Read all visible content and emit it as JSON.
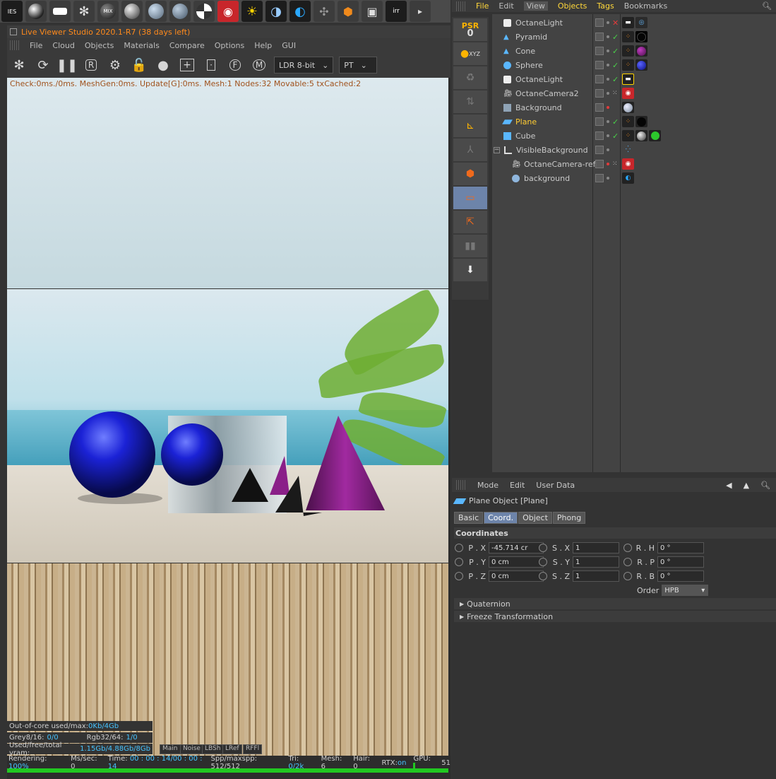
{
  "toolbar": {
    "first_label": "IES",
    "mix_label": "MIX"
  },
  "viewer": {
    "title": "Live Viewer Studio 2020.1-R7 (38 days left)",
    "menu": [
      "File",
      "Cloud",
      "Objects",
      "Materials",
      "Compare",
      "Options",
      "Help",
      "GUI"
    ],
    "tone_select": "LDR 8-bit",
    "kernel_select": "PT",
    "render_status": "Check:0ms./0ms. MeshGen:0ms. Update[G]:0ms. Mesh:1 Nodes:32 Movable:5 txCached:2",
    "info": {
      "outofcore_label": "Out-of-core used/max:",
      "outofcore_value": "0Kb/4Gb",
      "grey_label": "Grey8/16:",
      "grey_value": "0/0",
      "rgb_label": "Rgb32/64:",
      "rgb_value": "1/0",
      "vram_label": "Used/free/total vram:",
      "vram_value": "1.15Gb/4.88Gb/8Gb"
    },
    "passes": [
      "Main",
      "Noise",
      "LBSh",
      "LRef",
      "RFFl"
    ],
    "status": {
      "rendering_label": "Rendering:",
      "rendering_value": "100%",
      "mssec_label": "Ms/sec:",
      "mssec_value": "0",
      "time_label": "Time:",
      "time_value": "00 : 00 : 14/00 : 00 : 14",
      "spp_label": "Spp/maxspp:",
      "spp_value": "512/512",
      "tri_label": "Tri:",
      "tri_value": "0/2k",
      "mesh_label": "Mesh:",
      "mesh_value": "6",
      "hair_label": "Hair:",
      "hair_value": "0",
      "rtx_label": "RTX:",
      "rtx_value": "on",
      "gpu_label": "GPU:",
      "gpu_value": "51"
    },
    "progress": 1.0
  },
  "side_icons": {
    "psr_label": "PSR",
    "psr_value": "0",
    "xyz_label": "XYZ"
  },
  "object_manager": {
    "menu": [
      "File",
      "Edit",
      "View",
      "Objects",
      "Tags",
      "Bookmarks"
    ],
    "objects": [
      {
        "name": "OctaneLight"
      },
      {
        "name": "Pyramid"
      },
      {
        "name": "Cone"
      },
      {
        "name": "Sphere"
      },
      {
        "name": "OctaneLight"
      },
      {
        "name": "OctaneCamera2"
      },
      {
        "name": "Background"
      },
      {
        "name": "Plane"
      },
      {
        "name": "Cube"
      },
      {
        "name": "VisibleBackground"
      },
      {
        "name": "OctaneCamera-ref"
      },
      {
        "name": "background"
      }
    ]
  },
  "attribute_manager": {
    "menu": [
      "Mode",
      "Edit",
      "User Data"
    ],
    "title": "Plane Object [Plane]",
    "tabs": [
      "Basic",
      "Coord.",
      "Object",
      "Phong"
    ],
    "section": "Coordinates",
    "px_label": "P . X",
    "px_value": "-45.714 cr",
    "py_label": "P . Y",
    "py_value": "0 cm",
    "pz_label": "P . Z",
    "pz_value": "0 cm",
    "sx_label": "S . X",
    "sx_value": "1",
    "sy_label": "S . Y",
    "sy_value": "1",
    "sz_label": "S . Z",
    "sz_value": "1",
    "rh_label": "R . H",
    "rh_value": "0 °",
    "rp_label": "R . P",
    "rp_value": "0 °",
    "rb_label": "R . B",
    "rb_value": "0 °",
    "order_label": "Order",
    "order_value": "HPB",
    "folds": [
      "Quaternion",
      "Freeze Transformation"
    ]
  }
}
